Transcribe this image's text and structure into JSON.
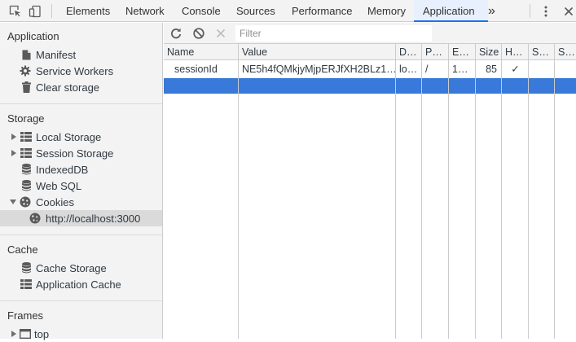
{
  "toolbar": {
    "inspect_icon": "inspect-element-icon",
    "device_icon": "device-toolbar-icon",
    "tabs": [
      "Elements",
      "Network",
      "Console",
      "Sources",
      "Performance",
      "Memory",
      "Application"
    ],
    "active_tab": "Application",
    "overflow_label": "»",
    "menu_icon": "kebab-menu-icon",
    "close_label": "✕"
  },
  "sidebar": {
    "application": {
      "title": "Application",
      "items": [
        {
          "label": "Manifest",
          "icon": "document-icon"
        },
        {
          "label": "Service Workers",
          "icon": "gear-icon"
        },
        {
          "label": "Clear storage",
          "icon": "trash-icon"
        }
      ]
    },
    "storage": {
      "title": "Storage",
      "items": [
        {
          "label": "Local Storage",
          "icon": "grid-icon",
          "expandable": true,
          "expanded": false
        },
        {
          "label": "Session Storage",
          "icon": "grid-icon",
          "expandable": true,
          "expanded": false
        },
        {
          "label": "IndexedDB",
          "icon": "database-icon"
        },
        {
          "label": "Web SQL",
          "icon": "database-icon"
        },
        {
          "label": "Cookies",
          "icon": "cookie-icon",
          "expandable": true,
          "expanded": true
        },
        {
          "label": "http://localhost:3000",
          "icon": "cookie-icon",
          "selected": true
        }
      ]
    },
    "cache": {
      "title": "Cache",
      "items": [
        {
          "label": "Cache Storage",
          "icon": "database-icon"
        },
        {
          "label": "Application Cache",
          "icon": "grid-icon"
        }
      ]
    },
    "frames": {
      "title": "Frames",
      "items": [
        {
          "label": "top",
          "icon": "frame-icon",
          "expandable": true,
          "expanded": false
        }
      ]
    }
  },
  "main": {
    "refresh_icon": "refresh-icon",
    "clear_all_icon": "block-icon",
    "delete_icon": "close-icon",
    "filter_placeholder": "Filter",
    "filter_value": "",
    "table": {
      "columns": [
        "Name",
        "Value",
        "D…",
        "P…",
        "E…",
        "Size",
        "H…",
        "S…",
        "S…"
      ],
      "rows": [
        [
          "sessionId",
          "NE5h4fQMkjyMjpERJfXH2BLz1…",
          "lo…",
          "/",
          "1…",
          "85",
          "✓",
          "",
          ""
        ]
      ]
    }
  },
  "colors": {
    "accent": "#1a73e8",
    "selection": "#3879d9",
    "panel_bg": "#f3f3f3",
    "border": "#cccccc"
  }
}
